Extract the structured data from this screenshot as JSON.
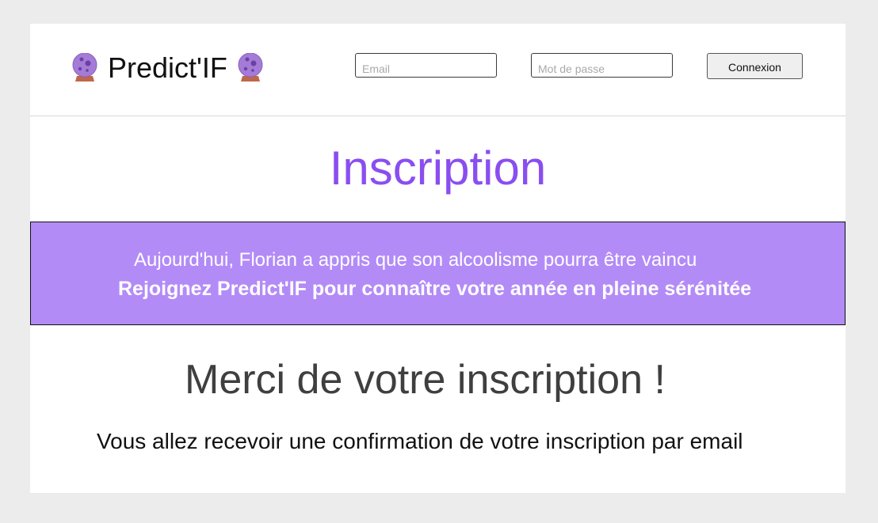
{
  "header": {
    "brand_name": "Predict'IF",
    "brand_icon": "crystal-ball-icon",
    "email_placeholder": "Email",
    "password_placeholder": "Mot de passe",
    "login_label": "Connexion"
  },
  "page": {
    "title": "Inscription"
  },
  "banner": {
    "line1": "Aujourd'hui, Florian a appris que son alcoolisme pourra être vaincu",
    "line2": "Rejoignez Predict'IF pour connaître votre année en pleine sérénitée"
  },
  "content": {
    "heading": "Merci de votre inscription !",
    "message": "Vous allez recevoir une confirmation de votre inscription par email"
  },
  "colors": {
    "accent": "#8a4ef0",
    "banner": "#b38bf7",
    "background": "#ececec"
  }
}
